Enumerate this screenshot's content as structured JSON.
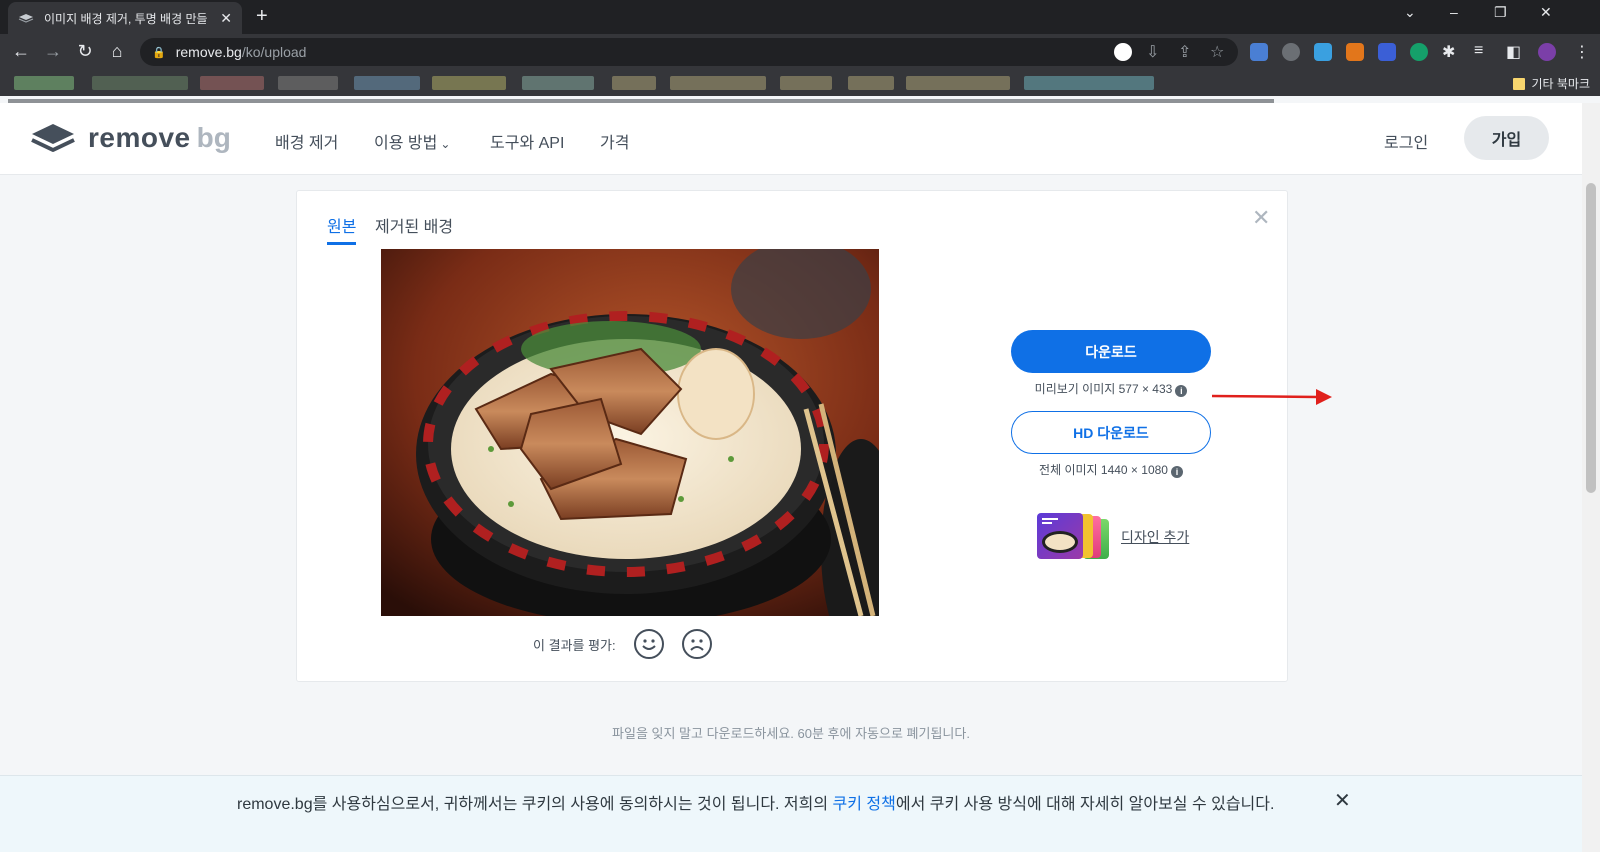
{
  "browser": {
    "tab_title": "이미지 배경 제거, 투명 배경 만들",
    "url_domain": "remove.bg",
    "url_path": "/ko/upload",
    "other_bookmarks": "기타 북마크"
  },
  "header": {
    "logo_word1": "remove",
    "logo_word2": "bg",
    "nav": [
      "배경 제거",
      "이용 방법",
      "도구와 API",
      "가격"
    ],
    "login": "로그인",
    "signup": "가입"
  },
  "card": {
    "tab_original": "원본",
    "tab_removed": "제거된 배경",
    "rate_label": "이 결과를 평가:",
    "download_label": "다운로드",
    "download_meta": "미리보기 이미지 577 × 433",
    "hd_download_label": "HD 다운로드",
    "hd_meta": "전체 이미지 1440 × 1080",
    "design_link": "디자인 추가"
  },
  "notice": "파일을 잊지 말고 다운로드하세요. 60분 후에 자동으로 폐기됩니다.",
  "cookie": {
    "text_before": "remove.bg를 사용하심으로서, 귀하께서는 쿠키의 사용에 동의하시는 것이 됩니다. 저희의 ",
    "link": "쿠키 정책",
    "text_after": "에서 쿠키 사용 방식에 대해 자세히 알아보실 수 있습니다."
  },
  "colors": {
    "accent": "#0f70e6",
    "annotation_arrow": "#e0201c"
  }
}
